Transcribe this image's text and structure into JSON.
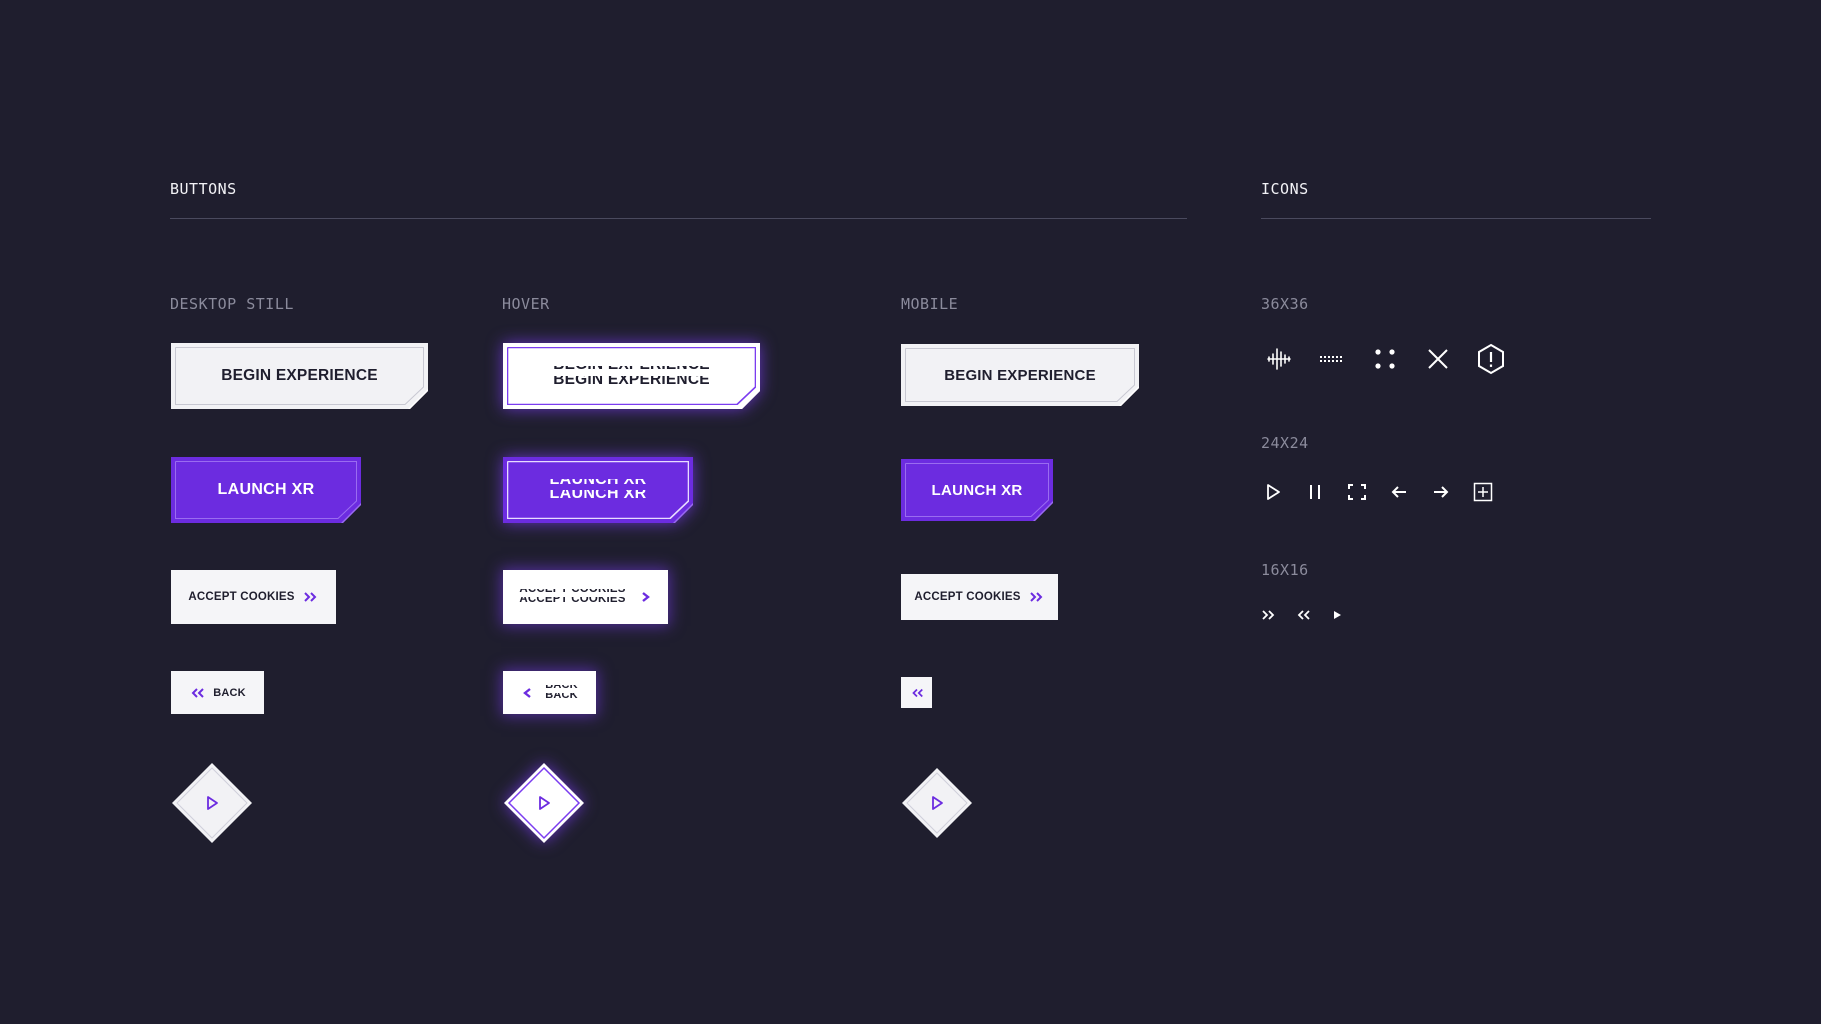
{
  "sections": {
    "buttons_title": "BUTTONS",
    "icons_title": "ICONS"
  },
  "columns": {
    "desktop": "DESKTOP STILL",
    "hover": "HOVER",
    "mobile": "MOBILE"
  },
  "buttons": {
    "begin": "BEGIN EXPERIENCE",
    "launch": "LAUNCH XR",
    "accept": "ACCEPT COOKIES",
    "back": "BACK"
  },
  "icon_sizes": {
    "large": "36X36",
    "medium": "24X24",
    "small": "16X16"
  },
  "icons": {
    "large": [
      "audio-waveform-icon",
      "dotted-line-icon",
      "four-dots-icon",
      "close-icon",
      "warning-hexagon-icon"
    ],
    "medium": [
      "play-icon",
      "pause-icon",
      "fullscreen-icon",
      "arrow-left-icon",
      "arrow-right-icon",
      "add-box-icon"
    ],
    "small": [
      "double-chevron-right-icon",
      "double-chevron-left-icon",
      "play-small-icon"
    ]
  },
  "colors": {
    "background": "#1f1e2e",
    "accent": "#6c2ce0",
    "light": "#f2f2f5",
    "muted": "#8b8b9c"
  }
}
